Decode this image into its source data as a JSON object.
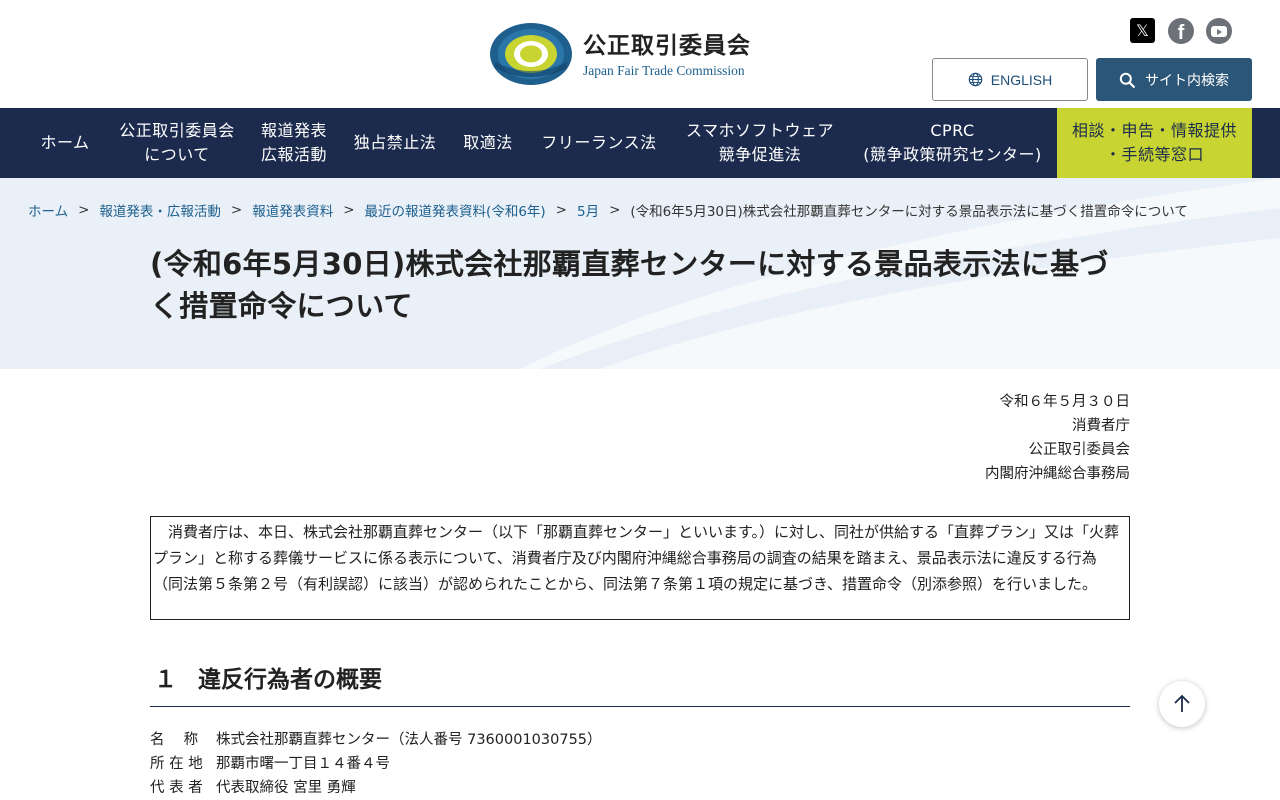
{
  "header": {
    "logo_ja": "公正取引委員会",
    "logo_en": "Japan Fair Trade Commission",
    "logo_ring_text": "JAPAN FAIR TRADE COMMISSION",
    "english_label": "ENGLISH",
    "search_label": "サイト内検索",
    "social": {
      "x": "𝕏",
      "facebook": "f"
    },
    "colors": {
      "brand": "#1c2b4d",
      "accent": "#c7d431",
      "link": "#1d5f8e",
      "search_btn": "#2c5677"
    }
  },
  "nav": {
    "items": [
      {
        "line1": "ホーム",
        "line2": ""
      },
      {
        "line1": "公正取引委員会",
        "line2": "について"
      },
      {
        "line1": "報道発表",
        "line2": "広報活動"
      },
      {
        "line1": "独占禁止法",
        "line2": ""
      },
      {
        "line1": "取適法",
        "line2": ""
      },
      {
        "line1": "フリーランス法",
        "line2": ""
      },
      {
        "line1": "スマホソフトウェア",
        "line2": "競争促進法"
      },
      {
        "line1": "CPRC",
        "line2": "(競争政策研究センター)"
      },
      {
        "line1": "相談・申告・情報提供",
        "line2": "・手続等窓口"
      }
    ]
  },
  "breadcrumb": {
    "links": [
      "ホーム",
      "報道発表・広報活動",
      "報道発表資料",
      "最近の報道発表資料(令和6年)",
      "5月"
    ],
    "separator": ">",
    "current": "(令和6年5月30日)株式会社那覇直葬センターに対する景品表示法に基づく措置命令について"
  },
  "page": {
    "title_line1": "(令和6年5月30日)株式会社那覇直葬センターに対する景品表示法に基づ",
    "title_line2": "く措置命令について"
  },
  "issuers": {
    "date": "令和６年５月３０日",
    "agency1": "消費者庁",
    "agency2": "公正取引委員会",
    "agency3": "内閣府沖縄総合事務局"
  },
  "summary": {
    "text": "消費者庁は、本日、株式会社那覇直葬センター（以下「那覇直葬センター」といいます。）に対し、同社が供給する「直葬プラン」又は「火葬プラン」と称する葬儀サービスに係る表示について、消費者庁及び内閣府沖縄総合事務局の調査の結果を踏まえ、景品表示法に違反する行為（同法第５条第２号（有利誤認）に該当）が認められたことから、同法第７条第１項の規定に基づき、措置命令（別添参照）を行いました。"
  },
  "section1": {
    "number": "１",
    "title": "違反行為者の概要",
    "rows": [
      {
        "label": "名　 称",
        "value": "株式会社那覇直葬センター（法人番号 7360001030755）"
      },
      {
        "label": "所 在 地",
        "value": "那覇市曙一丁目１４番４号"
      },
      {
        "label": "代 表 者",
        "value": "代表取締役 宮里 勇輝"
      }
    ]
  }
}
